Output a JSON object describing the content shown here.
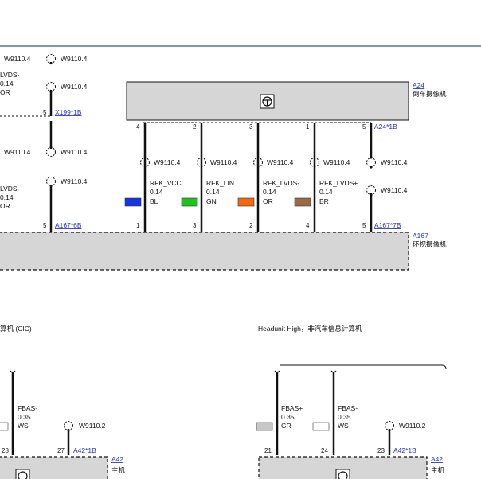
{
  "colors": {
    "wire": "#111111",
    "module_fill": "#d6d6d6",
    "link": "#1f2fd0",
    "frame": "#4d7a8c",
    "BL": "#1436e0",
    "GN": "#1fc21f",
    "OR": "#f26a10",
    "BR": "#9b6a45",
    "GR": "#c8c8c8",
    "WS": "#ffffff"
  },
  "icons": [
    "wrench-icon",
    "ground-shield-icon"
  ],
  "modules": {
    "a24": {
      "id": "A24",
      "name": "倒车摄像机",
      "connector": "A24*1B"
    },
    "a167": {
      "id": "A167",
      "name": "环视摄像机",
      "connector_left": "A167*6B",
      "connector_right": "A167*7B"
    },
    "a42_left": {
      "id": "A42",
      "name": "主机",
      "connector": "A42*1B",
      "caption": "算机 (CIC)"
    },
    "a42_right": {
      "id": "A42",
      "name": "主机",
      "connector": "A42*1B",
      "caption": "Headunit High，非汽车信息计算机"
    }
  },
  "left_fragment": {
    "x199_connector": "X199*1B",
    "wires": [
      {
        "name": "LVDS-",
        "size": "0.14",
        "color": "OR"
      },
      {
        "name": "LVDS-",
        "size": "0.14",
        "color": "OR"
      }
    ]
  },
  "shield_label": "W9110.4",
  "shield_label_bottom": "W9110.2",
  "pins": {
    "a24": [
      "4",
      "2",
      "3",
      "1",
      "5"
    ],
    "a167": [
      "1",
      "3",
      "2",
      "4",
      "5"
    ],
    "x199": "5",
    "a167_left": "5",
    "a42_left": [
      "28",
      "27"
    ],
    "a42_right": [
      "21",
      "24",
      "23"
    ]
  },
  "wires": [
    {
      "name": "RFK_VCC",
      "size": "0.14",
      "color": "BL"
    },
    {
      "name": "RFK_LIN",
      "size": "0.14",
      "color": "GN"
    },
    {
      "name": "RFK_LVDS-",
      "size": "0.14",
      "color": "OR"
    },
    {
      "name": "RFK_LVDS+",
      "size": "0.14",
      "color": "BR"
    }
  ],
  "bottom_wires_left": [
    {
      "name": "FBAS-",
      "size": "0.35",
      "color": "WS"
    }
  ],
  "bottom_wires_right": [
    {
      "name": "FBAS+",
      "size": "0.35",
      "color": "GR"
    },
    {
      "name": "FBAS-",
      "size": "0.35",
      "color": "WS"
    }
  ]
}
